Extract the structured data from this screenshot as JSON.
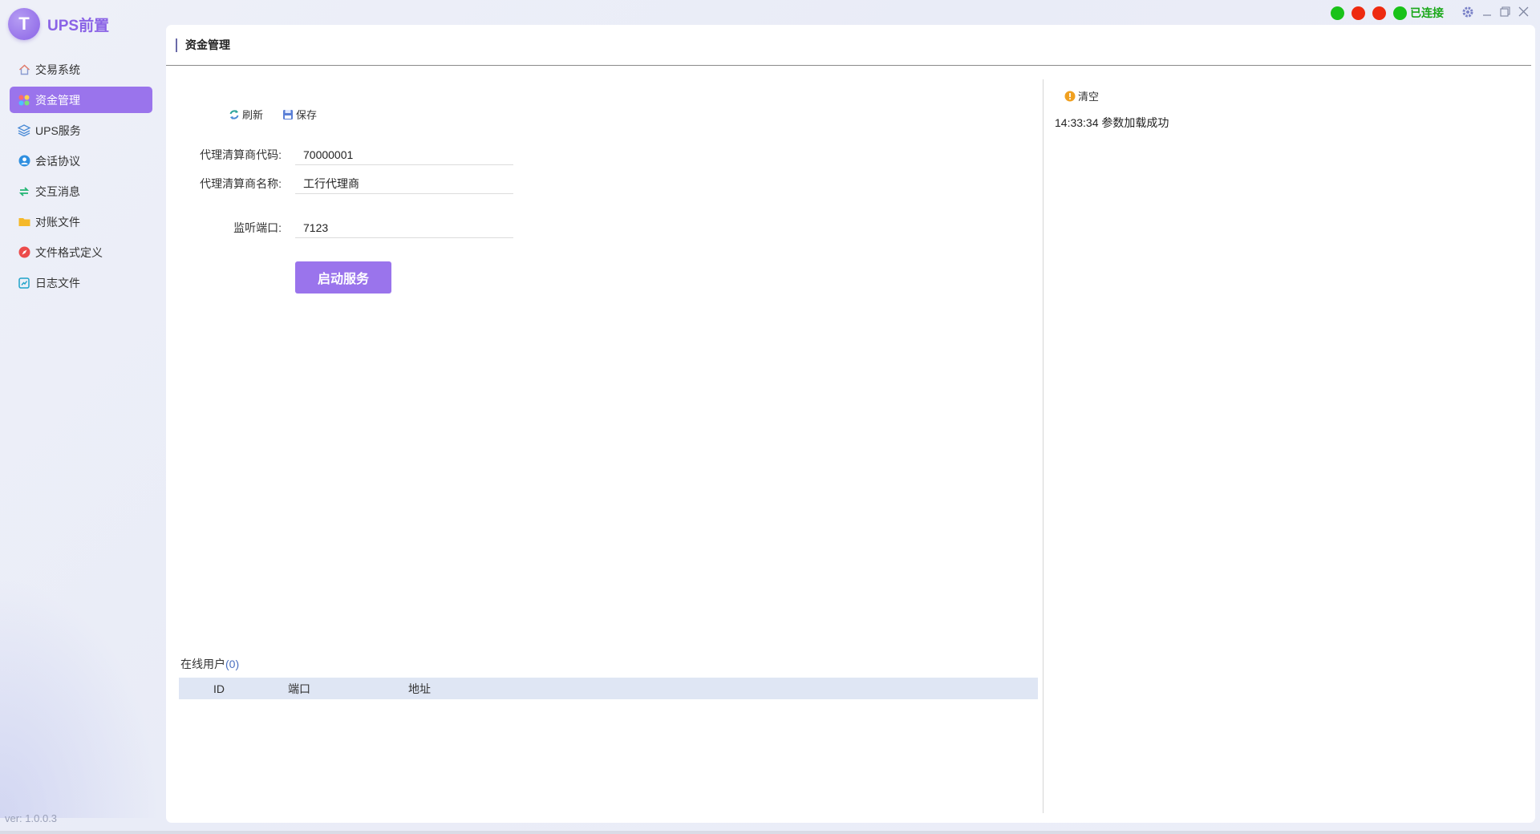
{
  "app": {
    "title": "UPS前置",
    "logo_letter": "T",
    "version": "ver: 1.0.0.3"
  },
  "sidebar": {
    "items": [
      {
        "label": "交易系统",
        "icon": "home-icon",
        "active": false
      },
      {
        "label": "资金管理",
        "icon": "grid-dots-icon",
        "active": true
      },
      {
        "label": "UPS服务",
        "icon": "layers-icon",
        "active": false
      },
      {
        "label": "会话协议",
        "icon": "user-circle-icon",
        "active": false
      },
      {
        "label": "交互消息",
        "icon": "exchange-icon",
        "active": false
      },
      {
        "label": "对账文件",
        "icon": "folder-icon",
        "active": false
      },
      {
        "label": "文件格式定义",
        "icon": "compass-icon",
        "active": false
      },
      {
        "label": "日志文件",
        "icon": "log-icon",
        "active": false
      }
    ]
  },
  "status": {
    "indicators": [
      {
        "name": "indicator-1",
        "color": "#19c219"
      },
      {
        "name": "indicator-2",
        "color": "#ee2a10"
      },
      {
        "name": "indicator-3",
        "color": "#ee2a10"
      },
      {
        "name": "indicator-4",
        "color": "#19c219"
      }
    ],
    "connection_text": "已连接"
  },
  "page": {
    "title": "资金管理"
  },
  "toolbar": {
    "refresh_label": "刷新",
    "save_label": "保存"
  },
  "form": {
    "agent_code_label": "代理清算商代码:",
    "agent_code_value": "70000001",
    "agent_name_label": "代理清算商名称:",
    "agent_name_value": "工行代理商",
    "port_label": "监听端口:",
    "port_value": "7123",
    "start_button": "启动服务"
  },
  "online_users": {
    "title": "在线用户",
    "count": "(0)",
    "columns": [
      "ID",
      "端口",
      "地址"
    ]
  },
  "log": {
    "clear_label": "清空",
    "entries": [
      "14:33:34 参数加载成功"
    ]
  },
  "colors": {
    "accent": "#9a74ec",
    "connected": "#1aa81a"
  }
}
